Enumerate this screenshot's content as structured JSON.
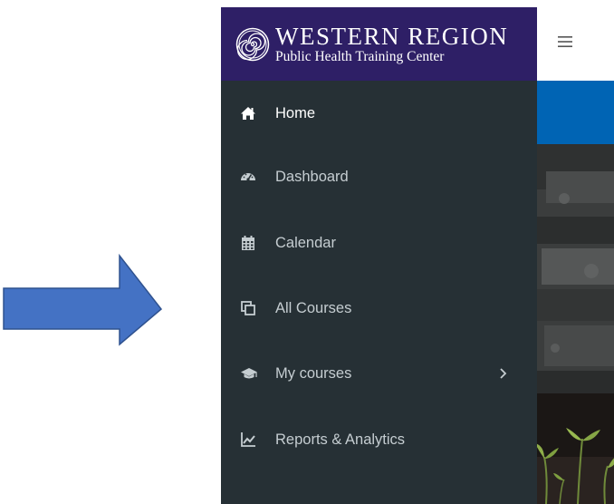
{
  "brand": {
    "title_line1": "WESTERN REGION",
    "title_line2": "Public Health Training Center",
    "logo_icon": "spiral-logo-icon",
    "background_color": "#2e1f66"
  },
  "header": {
    "menu_toggle_icon": "hamburger-icon",
    "menu_toggle_glyph": "≡"
  },
  "sidebar": {
    "background_color": "#263035",
    "items": [
      {
        "label": "Home",
        "icon": "home-icon",
        "active": true
      },
      {
        "label": "Dashboard",
        "icon": "dashboard-gauge-icon",
        "active": false
      },
      {
        "label": "Calendar",
        "icon": "calendar-icon",
        "active": false
      },
      {
        "label": "All Courses",
        "icon": "copy-pages-icon",
        "active": false
      },
      {
        "label": "My courses",
        "icon": "graduation-cap-icon",
        "active": false,
        "has_submenu": true
      },
      {
        "label": "Reports & Analytics",
        "icon": "line-chart-icon",
        "active": false
      }
    ]
  },
  "annotation": {
    "arrow_color": "#4472c4",
    "arrow_direction": "right"
  },
  "colors": {
    "accent_band": "#0064b4",
    "text_active": "#ffffff",
    "text_inactive": "#c5cdd1"
  }
}
